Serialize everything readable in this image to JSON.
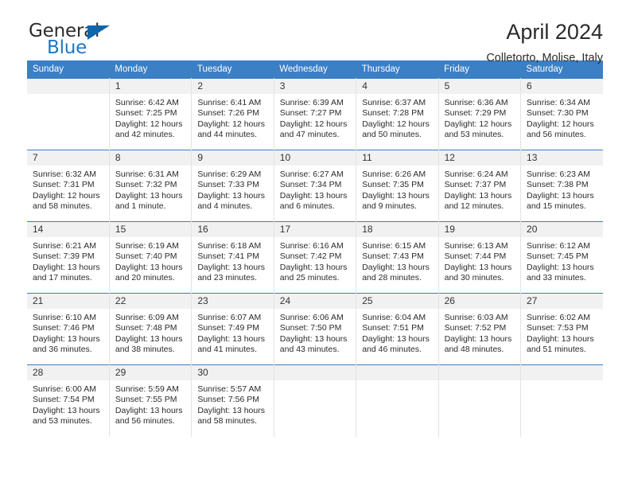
{
  "brand": {
    "name_part1": "General",
    "name_part2": "Blue",
    "accent_color": "#1165ab",
    "text_color": "#2b2b2b"
  },
  "header": {
    "title": "April 2024",
    "subtitle": "Colletorto, Molise, Italy",
    "header_bg": "#3b7fc4",
    "daynum_bg": "#f1f1f1"
  },
  "weekdays": [
    "Sunday",
    "Monday",
    "Tuesday",
    "Wednesday",
    "Thursday",
    "Friday",
    "Saturday"
  ],
  "labels": {
    "sunrise_prefix": "Sunrise:",
    "sunset_prefix": "Sunset:",
    "daylight_prefix": "Daylight:"
  },
  "weeks": [
    [
      {
        "day": "",
        "line1": "",
        "line2": "",
        "line3": "",
        "line4": ""
      },
      {
        "day": "1",
        "line1": "Sunrise: 6:42 AM",
        "line2": "Sunset: 7:25 PM",
        "line3": "Daylight: 12 hours",
        "line4": "and 42 minutes."
      },
      {
        "day": "2",
        "line1": "Sunrise: 6:41 AM",
        "line2": "Sunset: 7:26 PM",
        "line3": "Daylight: 12 hours",
        "line4": "and 44 minutes."
      },
      {
        "day": "3",
        "line1": "Sunrise: 6:39 AM",
        "line2": "Sunset: 7:27 PM",
        "line3": "Daylight: 12 hours",
        "line4": "and 47 minutes."
      },
      {
        "day": "4",
        "line1": "Sunrise: 6:37 AM",
        "line2": "Sunset: 7:28 PM",
        "line3": "Daylight: 12 hours",
        "line4": "and 50 minutes."
      },
      {
        "day": "5",
        "line1": "Sunrise: 6:36 AM",
        "line2": "Sunset: 7:29 PM",
        "line3": "Daylight: 12 hours",
        "line4": "and 53 minutes."
      },
      {
        "day": "6",
        "line1": "Sunrise: 6:34 AM",
        "line2": "Sunset: 7:30 PM",
        "line3": "Daylight: 12 hours",
        "line4": "and 56 minutes."
      }
    ],
    [
      {
        "day": "7",
        "line1": "Sunrise: 6:32 AM",
        "line2": "Sunset: 7:31 PM",
        "line3": "Daylight: 12 hours",
        "line4": "and 58 minutes."
      },
      {
        "day": "8",
        "line1": "Sunrise: 6:31 AM",
        "line2": "Sunset: 7:32 PM",
        "line3": "Daylight: 13 hours",
        "line4": "and 1 minute."
      },
      {
        "day": "9",
        "line1": "Sunrise: 6:29 AM",
        "line2": "Sunset: 7:33 PM",
        "line3": "Daylight: 13 hours",
        "line4": "and 4 minutes."
      },
      {
        "day": "10",
        "line1": "Sunrise: 6:27 AM",
        "line2": "Sunset: 7:34 PM",
        "line3": "Daylight: 13 hours",
        "line4": "and 6 minutes."
      },
      {
        "day": "11",
        "line1": "Sunrise: 6:26 AM",
        "line2": "Sunset: 7:35 PM",
        "line3": "Daylight: 13 hours",
        "line4": "and 9 minutes."
      },
      {
        "day": "12",
        "line1": "Sunrise: 6:24 AM",
        "line2": "Sunset: 7:37 PM",
        "line3": "Daylight: 13 hours",
        "line4": "and 12 minutes."
      },
      {
        "day": "13",
        "line1": "Sunrise: 6:23 AM",
        "line2": "Sunset: 7:38 PM",
        "line3": "Daylight: 13 hours",
        "line4": "and 15 minutes."
      }
    ],
    [
      {
        "day": "14",
        "line1": "Sunrise: 6:21 AM",
        "line2": "Sunset: 7:39 PM",
        "line3": "Daylight: 13 hours",
        "line4": "and 17 minutes."
      },
      {
        "day": "15",
        "line1": "Sunrise: 6:19 AM",
        "line2": "Sunset: 7:40 PM",
        "line3": "Daylight: 13 hours",
        "line4": "and 20 minutes."
      },
      {
        "day": "16",
        "line1": "Sunrise: 6:18 AM",
        "line2": "Sunset: 7:41 PM",
        "line3": "Daylight: 13 hours",
        "line4": "and 23 minutes."
      },
      {
        "day": "17",
        "line1": "Sunrise: 6:16 AM",
        "line2": "Sunset: 7:42 PM",
        "line3": "Daylight: 13 hours",
        "line4": "and 25 minutes."
      },
      {
        "day": "18",
        "line1": "Sunrise: 6:15 AM",
        "line2": "Sunset: 7:43 PM",
        "line3": "Daylight: 13 hours",
        "line4": "and 28 minutes."
      },
      {
        "day": "19",
        "line1": "Sunrise: 6:13 AM",
        "line2": "Sunset: 7:44 PM",
        "line3": "Daylight: 13 hours",
        "line4": "and 30 minutes."
      },
      {
        "day": "20",
        "line1": "Sunrise: 6:12 AM",
        "line2": "Sunset: 7:45 PM",
        "line3": "Daylight: 13 hours",
        "line4": "and 33 minutes."
      }
    ],
    [
      {
        "day": "21",
        "line1": "Sunrise: 6:10 AM",
        "line2": "Sunset: 7:46 PM",
        "line3": "Daylight: 13 hours",
        "line4": "and 36 minutes."
      },
      {
        "day": "22",
        "line1": "Sunrise: 6:09 AM",
        "line2": "Sunset: 7:48 PM",
        "line3": "Daylight: 13 hours",
        "line4": "and 38 minutes."
      },
      {
        "day": "23",
        "line1": "Sunrise: 6:07 AM",
        "line2": "Sunset: 7:49 PM",
        "line3": "Daylight: 13 hours",
        "line4": "and 41 minutes."
      },
      {
        "day": "24",
        "line1": "Sunrise: 6:06 AM",
        "line2": "Sunset: 7:50 PM",
        "line3": "Daylight: 13 hours",
        "line4": "and 43 minutes."
      },
      {
        "day": "25",
        "line1": "Sunrise: 6:04 AM",
        "line2": "Sunset: 7:51 PM",
        "line3": "Daylight: 13 hours",
        "line4": "and 46 minutes."
      },
      {
        "day": "26",
        "line1": "Sunrise: 6:03 AM",
        "line2": "Sunset: 7:52 PM",
        "line3": "Daylight: 13 hours",
        "line4": "and 48 minutes."
      },
      {
        "day": "27",
        "line1": "Sunrise: 6:02 AM",
        "line2": "Sunset: 7:53 PM",
        "line3": "Daylight: 13 hours",
        "line4": "and 51 minutes."
      }
    ],
    [
      {
        "day": "28",
        "line1": "Sunrise: 6:00 AM",
        "line2": "Sunset: 7:54 PM",
        "line3": "Daylight: 13 hours",
        "line4": "and 53 minutes."
      },
      {
        "day": "29",
        "line1": "Sunrise: 5:59 AM",
        "line2": "Sunset: 7:55 PM",
        "line3": "Daylight: 13 hours",
        "line4": "and 56 minutes."
      },
      {
        "day": "30",
        "line1": "Sunrise: 5:57 AM",
        "line2": "Sunset: 7:56 PM",
        "line3": "Daylight: 13 hours",
        "line4": "and 58 minutes."
      },
      {
        "day": "",
        "line1": "",
        "line2": "",
        "line3": "",
        "line4": ""
      },
      {
        "day": "",
        "line1": "",
        "line2": "",
        "line3": "",
        "line4": ""
      },
      {
        "day": "",
        "line1": "",
        "line2": "",
        "line3": "",
        "line4": ""
      },
      {
        "day": "",
        "line1": "",
        "line2": "",
        "line3": "",
        "line4": ""
      }
    ]
  ]
}
